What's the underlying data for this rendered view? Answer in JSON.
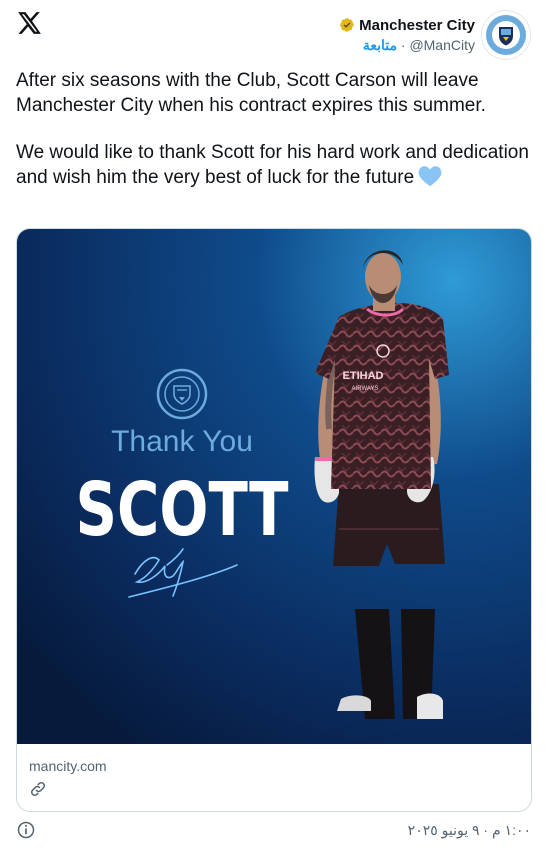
{
  "account": {
    "name": "Manchester City",
    "handle": "@ManCity",
    "separator": "·",
    "follow_label": "متابعة"
  },
  "tweet": {
    "paragraphs": [
      "After six seasons with the Club, Scott Carson will leave Manchester City when his contract expires this summer.",
      "We would like to thank Scott for his hard work and dedication and wish him the very best of luck for the future"
    ]
  },
  "card": {
    "headline": "Thank You",
    "name_big": "SCOTT",
    "crest_text": "MANCHESTER CITY",
    "sponsor": "ETIHAD",
    "sponsor_sub": "AIRWAYS",
    "domain": "mancity.com"
  },
  "timestamp": "١:٠٠ م · ٩ يونيو ٢٠٢٥",
  "colors": {
    "verified": "#e2b719",
    "link": "#1d9bf0",
    "card_bg_top": "#0b2b5c",
    "card_bg_bottom": "#06193a",
    "headline": "#6cabdd",
    "heart": "#89c4f4"
  },
  "icons": {
    "x_logo": "x-logo-icon",
    "verified": "verified-badge-icon",
    "heart": "light-blue-heart-icon",
    "link": "link-icon",
    "info": "info-icon"
  }
}
